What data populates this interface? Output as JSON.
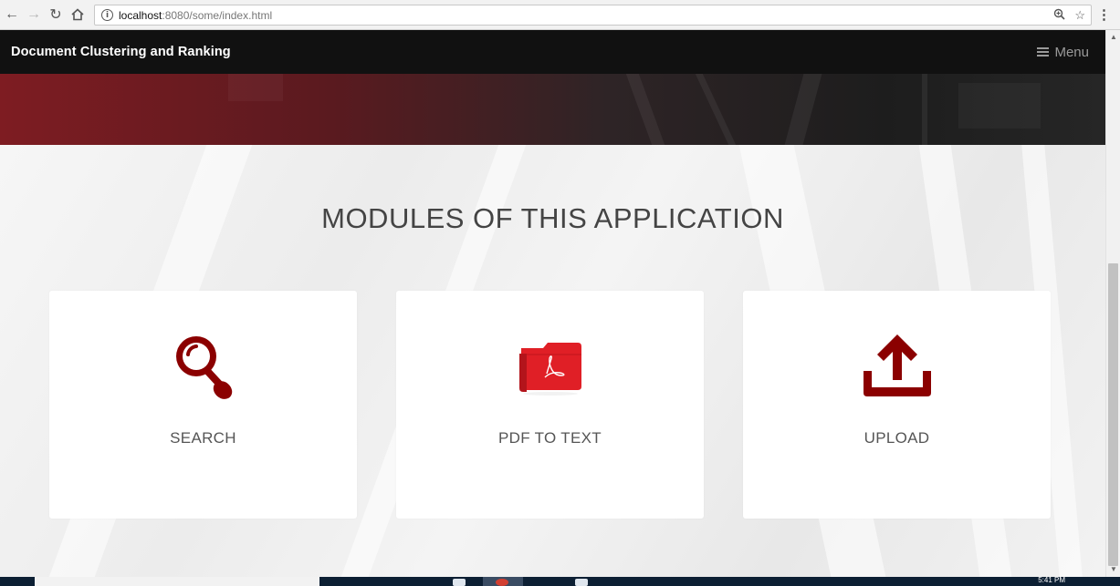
{
  "browser": {
    "url_host": "localhost",
    "url_rest": ":8080/some/index.html",
    "info_icon": "info-icon",
    "icons": [
      "back-arrow-icon",
      "forward-arrow-icon",
      "reload-icon",
      "home-icon",
      "zoom-icon",
      "star-icon",
      "kebab-menu-icon"
    ]
  },
  "navbar": {
    "brand": "Document Clustering and Ranking",
    "menu_label": "Menu",
    "menu_icon": "hamburger-icon"
  },
  "section": {
    "title": "MODULES OF THIS APPLICATION"
  },
  "modules": [
    {
      "label": "SEARCH",
      "icon": "magnifier-icon"
    },
    {
      "label": "PDF TO TEXT",
      "icon": "pdf-folder-icon"
    },
    {
      "label": "UPLOAD",
      "icon": "upload-icon"
    }
  ],
  "taskbar": {
    "clock": "5:41 PM"
  },
  "colors": {
    "navbar_bg": "#111111",
    "accent_red": "#8b0000",
    "pdf_red": "#e01f26",
    "text_gray": "#555555"
  }
}
